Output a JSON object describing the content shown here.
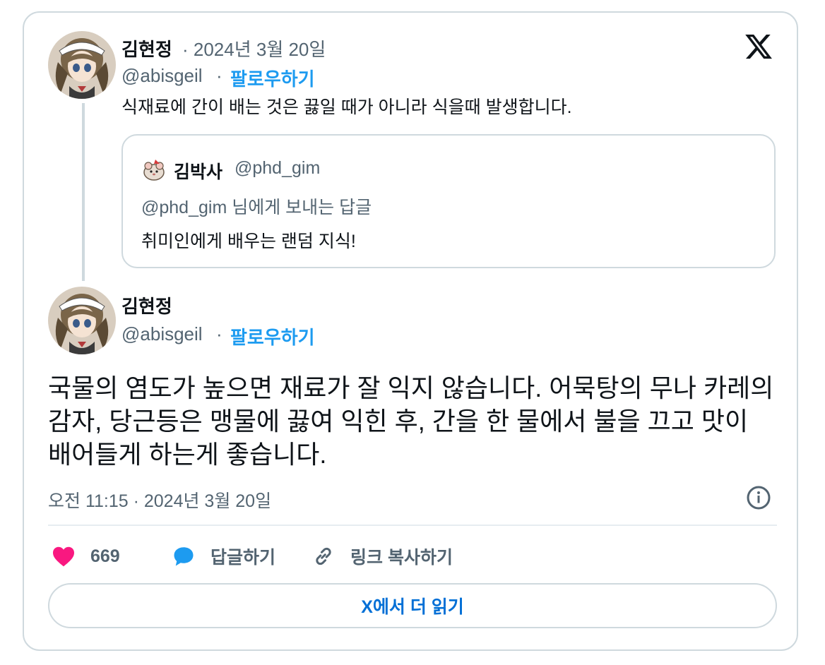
{
  "first_tweet": {
    "author_name": "김현정",
    "date": "· 2024년 3월 20일",
    "handle": "@abisgeil",
    "follow_label": "팔로우하기",
    "text": "식재료에 간이 배는 것은 끓일 때가 아니라 식을때 발생합니다.",
    "avatar_icon": "anime-character-avatar"
  },
  "quoted_tweet": {
    "author_name": "김박사",
    "handle": "@phd_gim",
    "reply_to": "@phd_gim 님에게 보내는 답글",
    "text": "취미인에게 배우는 랜덤 지식!",
    "avatar_icon": "cartoon-hamster-avatar"
  },
  "main_tweet": {
    "author_name": "김현정",
    "handle": "@abisgeil",
    "follow_label": "팔로우하기",
    "text": "국물의 염도가 높으면 재료가 잘 익지 않습니다. 어묵탕의 무나 카레의 감자, 당근등은 맹물에 끓여 익힌 후, 간을 한 물에서 불을 끄고 맛이 배어들게 하는게 좋습니다.",
    "timestamp": "오전 11:15 · 2024년 3월 20일"
  },
  "separator": "·",
  "actions": {
    "like_count": "669",
    "reply_label": "답글하기",
    "copy_link_label": "링크 복사하기"
  },
  "read_more_label": "X에서 더 읽기",
  "colors": {
    "accent": "#1d9bf0",
    "like": "#f91880",
    "link": "#006fd6",
    "muted": "#536471",
    "border": "#cfd9de"
  },
  "icons": {
    "brand": "x-logo-icon",
    "info": "info-icon",
    "like": "heart-icon",
    "reply": "speech-bubble-icon",
    "copy_link": "link-icon"
  }
}
